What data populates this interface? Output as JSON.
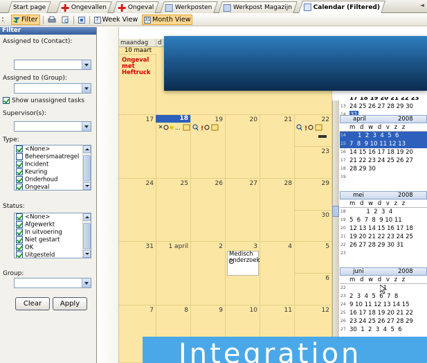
{
  "tabs": [
    {
      "label": "Start page",
      "icon": "none",
      "active": false
    },
    {
      "label": "Ongevallen",
      "icon": "red-cross-icon",
      "active": false
    },
    {
      "label": "Ongeval",
      "icon": "red-cross-icon",
      "active": false
    },
    {
      "label": "Werkposten",
      "icon": "page-icon",
      "active": false
    },
    {
      "label": "Werkpost Magazijn",
      "icon": "page-icon",
      "active": false
    },
    {
      "label": "Calendar (Filtered)",
      "icon": "calendar-icon",
      "active": true
    }
  ],
  "toolbar": {
    "filter_label": "Filter",
    "week_view_label": "Week View",
    "month_view_label": "Month View",
    "week_view_number": "7",
    "month_view_number": "31"
  },
  "filter": {
    "header": "Filter",
    "assigned_contact_label": "Assigned to (Contact):",
    "assigned_contact_value": "",
    "assigned_group_label": "Assigned to (Group):",
    "assigned_group_value": "",
    "show_unassigned_label": "Show unassigned tasks",
    "show_unassigned_checked": true,
    "supervisor_label": "Supervisor(s):",
    "supervisor_value": "",
    "type_label": "Type:",
    "type_items": [
      {
        "label": "<None>",
        "checked": true
      },
      {
        "label": "Beheersmaatregel",
        "checked": false
      },
      {
        "label": "Incident",
        "checked": true
      },
      {
        "label": "Keuring",
        "checked": true
      },
      {
        "label": "Onderhoud",
        "checked": true
      },
      {
        "label": "Ongeval",
        "checked": true
      }
    ],
    "status_label": "Status:",
    "status_items": [
      {
        "label": "<None>",
        "checked": true
      },
      {
        "label": "Afgewerkt",
        "checked": true
      },
      {
        "label": "In uitvoering",
        "checked": true
      },
      {
        "label": "Niet gestart",
        "checked": true
      },
      {
        "label": "OK",
        "checked": true
      },
      {
        "label": "Uitgesteld",
        "checked": true
      }
    ],
    "group_label": "Group:",
    "group_value": "",
    "clear_label": "Clear",
    "apply_label": "Apply"
  },
  "calendar": {
    "day_headers": [
      "maandag",
      "d"
    ],
    "first_row_date": "10 maart",
    "first_event": "Ongeval met Heftruck",
    "rows": [
      {
        "days": [
          "17",
          "18",
          "19",
          "20",
          "21",
          "22"
        ],
        "sunday": "23"
      },
      {
        "days": [
          "24",
          "25",
          "26",
          "27",
          "28",
          "29"
        ],
        "sunday": "30"
      },
      {
        "days": [
          "31",
          "1 april",
          "2",
          "3",
          "4",
          "5"
        ],
        "sunday": "6"
      },
      {
        "days": [
          "7",
          "8",
          "9",
          "10",
          "11",
          "12"
        ],
        "sunday": "13"
      }
    ],
    "today": "18",
    "event_medical": "Medisch onderzoek"
  },
  "mini_calendars": [
    {
      "month": "",
      "year": "",
      "weeks": [
        {
          "wk": "13",
          "days": "24 25 26 27 28 29 30"
        },
        {
          "wk": "14",
          "days": "31"
        }
      ],
      "top_fragment": "17 18 19 20 21 22 23"
    },
    {
      "month": "april",
      "year": "2008",
      "dow": "m d w d v z z",
      "weeks": [
        {
          "wk": "14",
          "days": "1  2  3  4  5  6"
        },
        {
          "wk": "15",
          "days": "7  8  9 10 11 12 13"
        },
        {
          "wk": "16",
          "days": "14 15 16 17 18 19 20"
        },
        {
          "wk": "17",
          "days": "21 22 23 24 25 26 27"
        },
        {
          "wk": "18",
          "days": "28 29 30"
        },
        {
          "wk": "19",
          "days": ""
        }
      ]
    },
    {
      "month": "mei",
      "year": "2008",
      "dow": "m d w d v z z",
      "weeks": [
        {
          "wk": "18",
          "days": "         1  2  3  4"
        },
        {
          "wk": "19",
          "days": "5  6  7  8  9 10 11"
        },
        {
          "wk": "20",
          "days": "12 13 14 15 16 17 18"
        },
        {
          "wk": "21",
          "days": "19 20 21 22 23 24 25"
        },
        {
          "wk": "22",
          "days": "26 27 28 29 30 31"
        },
        {
          "wk": "23",
          "days": ""
        }
      ]
    },
    {
      "month": "juni",
      "year": "2008",
      "dow": "m d w d v z z",
      "weeks": [
        {
          "wk": "22",
          "days": "                  1"
        },
        {
          "wk": "23",
          "days": "2  3  4  5  6  7  8"
        },
        {
          "wk": "24",
          "days": "9 10 11 12 13 14 15"
        },
        {
          "wk": "25",
          "days": "16 17 18 19 20 21 22"
        },
        {
          "wk": "26",
          "days": "23 24 25 26 27 28 29"
        },
        {
          "wk": "27",
          "days": "30  1  2  3  4  5  6"
        }
      ]
    }
  ],
  "overlay_text": "Integration",
  "colors": {
    "accent_blue": "#2d5fbc",
    "calendar_bg": "#fbe7a3",
    "event_red": "#d40000",
    "overlay_blue": "#4aa8e8"
  }
}
